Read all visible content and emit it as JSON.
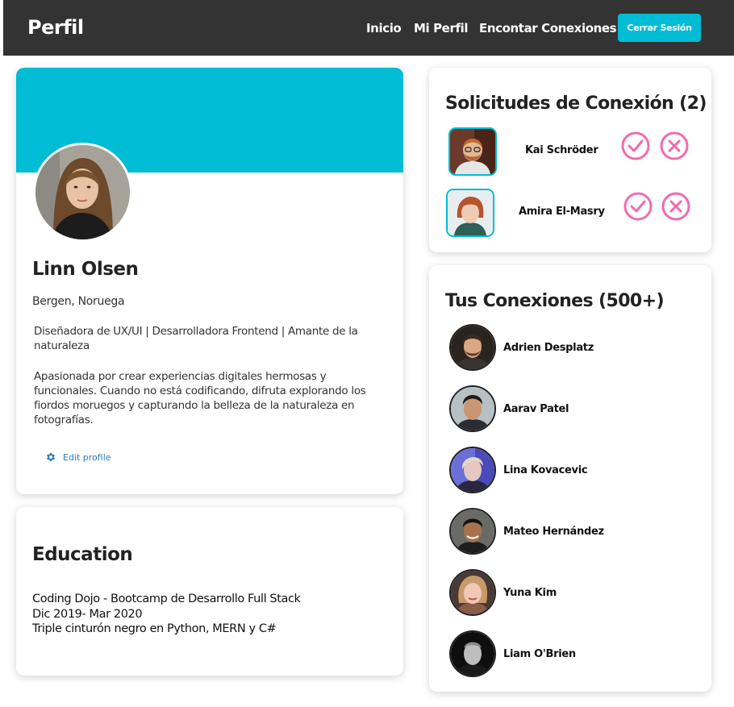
{
  "navbar": {
    "brand": "Perfil",
    "links": [
      "Inicio",
      "Mi Perfil",
      "Encontar Conexiones"
    ],
    "logout_label": "Cerrar Sesión",
    "accent_color": "#00bcd4"
  },
  "profile": {
    "name": "Linn Olsen",
    "location": "Bergen, Noruega",
    "headline": "Diseñadora de UX/UI | Desarrolladora Frontend | Amante de la naturaleza",
    "about": "Apasionada por crear experiencias digitales hermosas y funcionales. Cuando no está codificando, difruta explorando los fiordos moruegos y capturando la belleza de la naturaleza en fotografías.",
    "edit_label": "Edit profile",
    "edit_icon": "gear-icon"
  },
  "education": {
    "title": "Education",
    "lines": [
      "Coding Dojo - Bootcamp de Desarrollo Full Stack",
      "Dic 2019- Mar 2020",
      "Triple cinturón negro en Python, MERN y C#"
    ]
  },
  "requests": {
    "title": "Solicitudes de Conexión (2)",
    "items": [
      {
        "name": "Kai Schröder",
        "accept_icon": "check-circle-icon",
        "reject_icon": "x-circle-icon"
      },
      {
        "name": "Amira El-Masry",
        "accept_icon": "check-circle-icon",
        "reject_icon": "x-circle-icon"
      }
    ],
    "action_color": "#f06bb0"
  },
  "connections": {
    "title": "Tus Conexiones (500+)",
    "items": [
      {
        "name": "Adrien Desplatz"
      },
      {
        "name": "Aarav Patel"
      },
      {
        "name": "Lina Kovacevic"
      },
      {
        "name": "Mateo Hernández"
      },
      {
        "name": "Yuna Kim"
      },
      {
        "name": "Liam O'Brien"
      }
    ]
  }
}
